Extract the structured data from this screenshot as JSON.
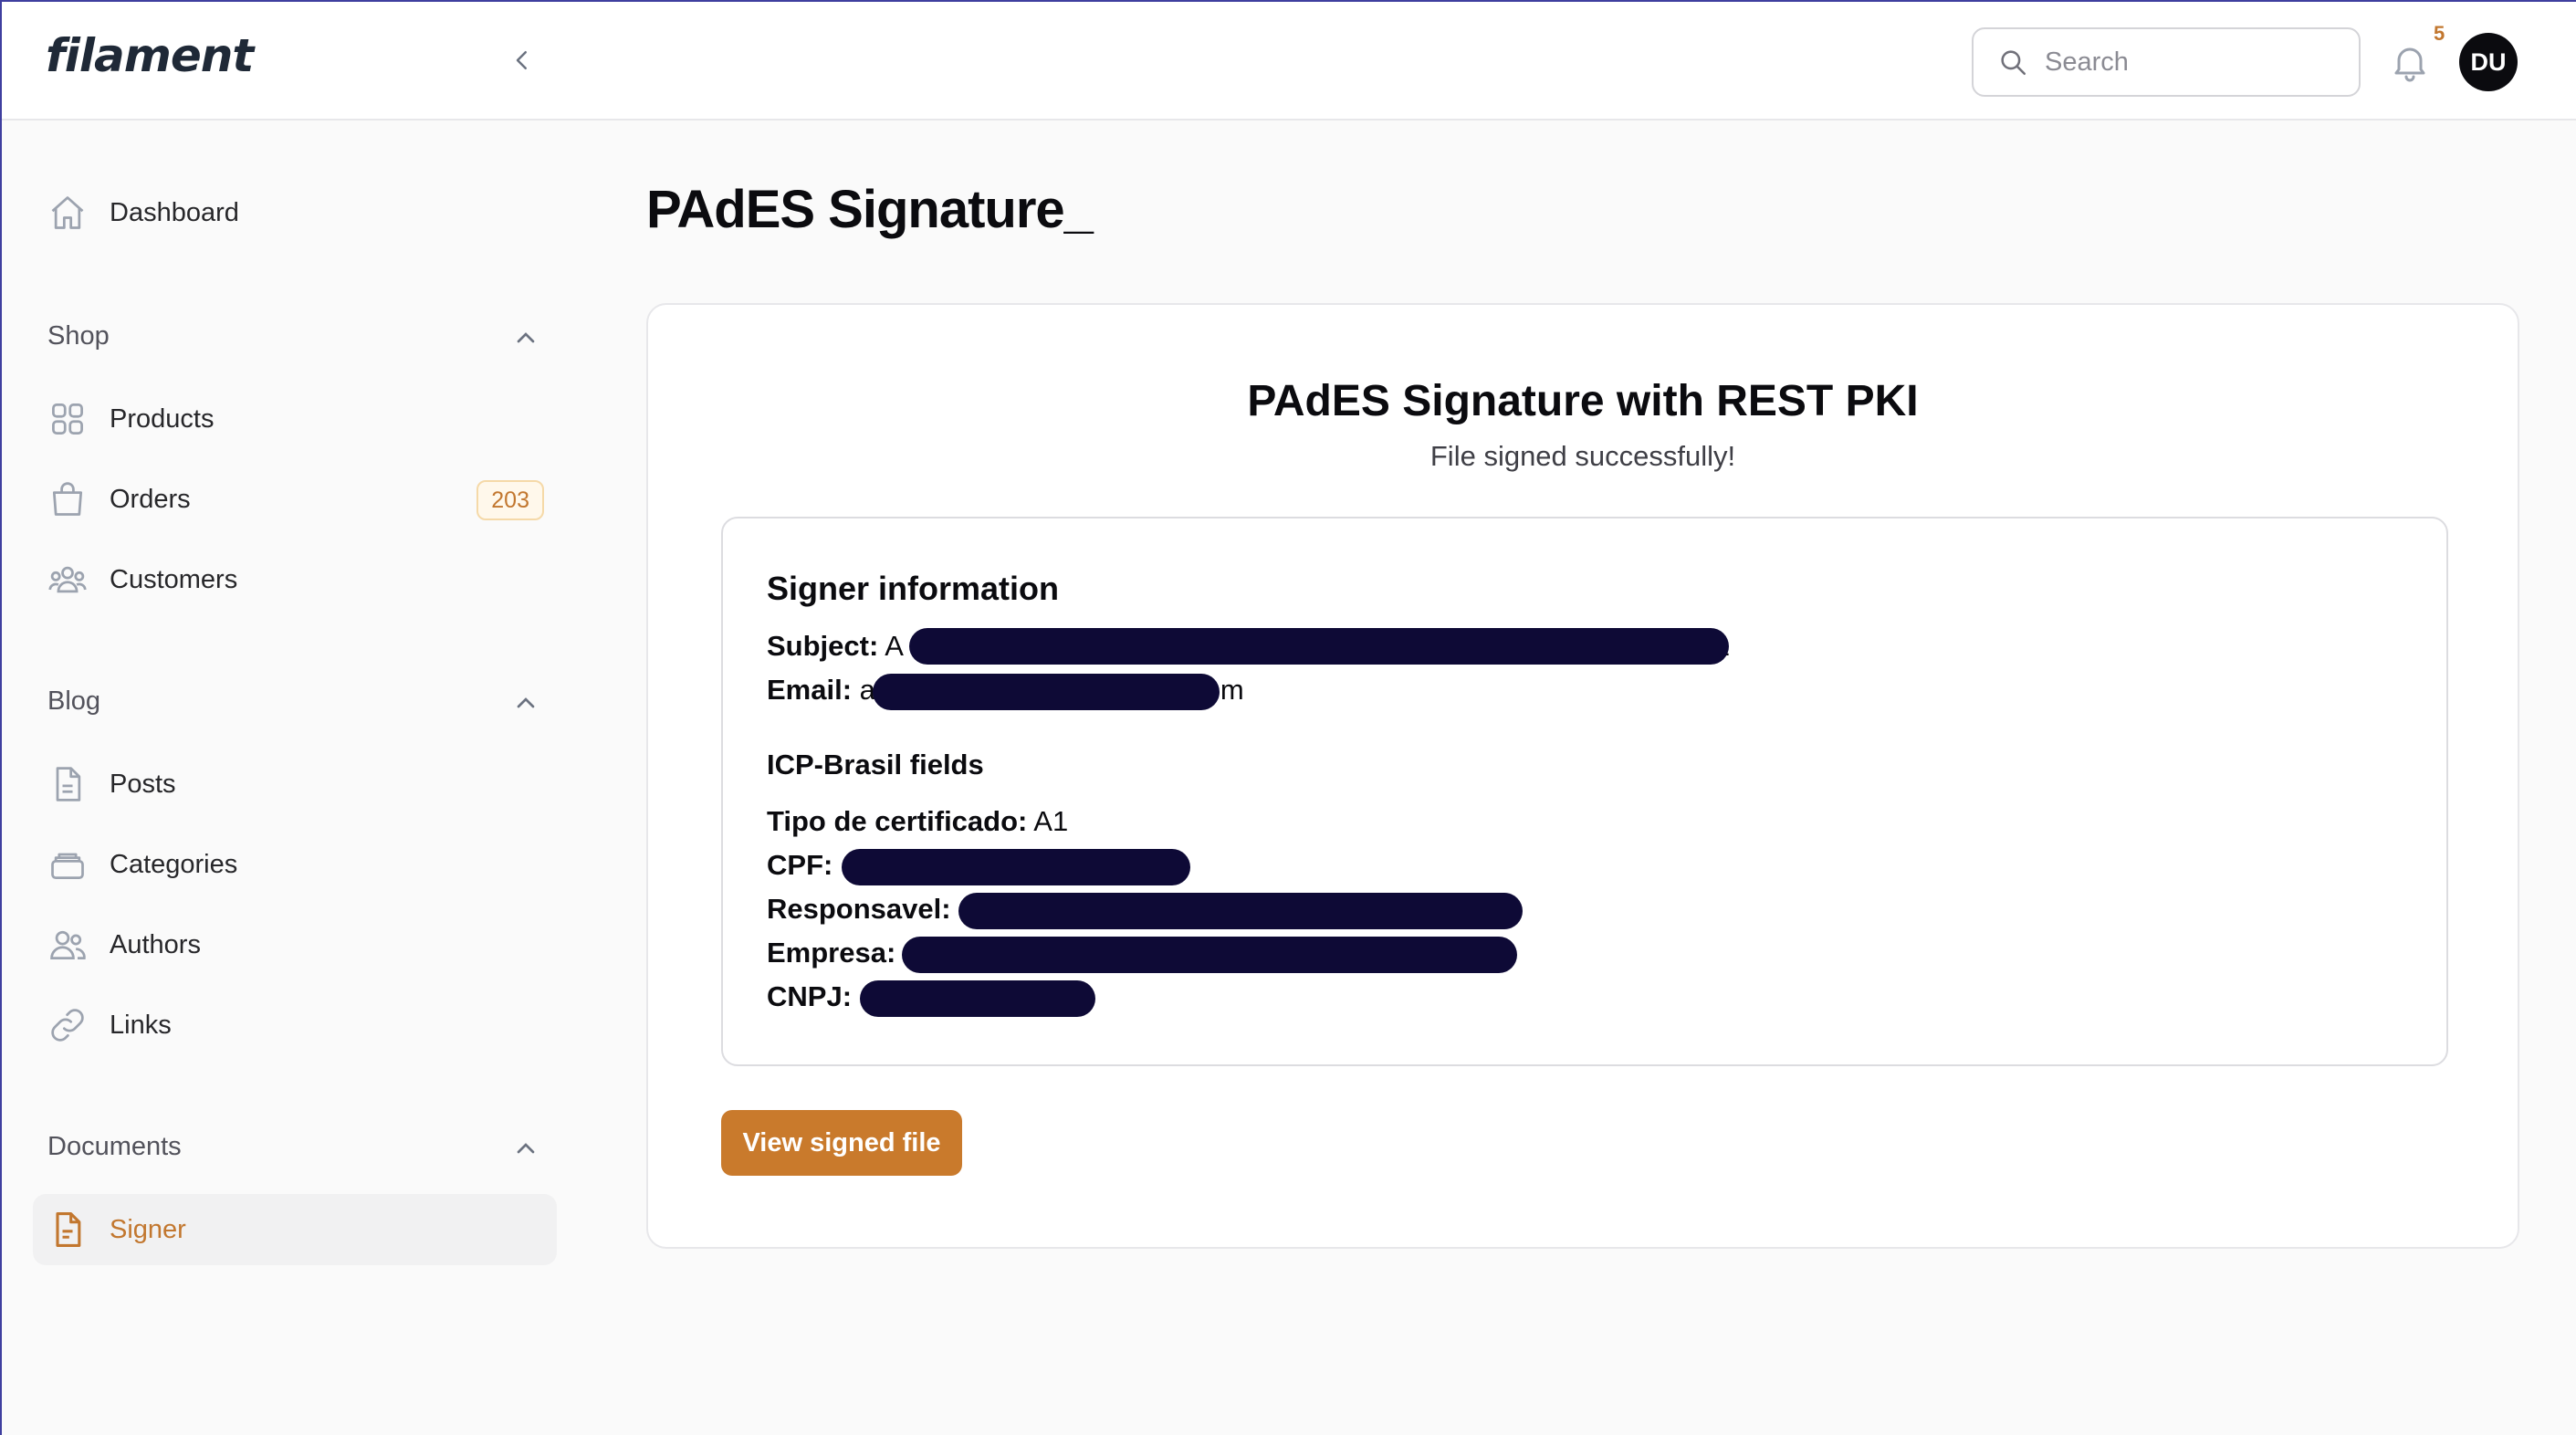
{
  "app": {
    "logo": "filament"
  },
  "header": {
    "search_placeholder": "Search",
    "notification_count": "5",
    "avatar_initials": "DU"
  },
  "sidebar": {
    "dashboard": "Dashboard",
    "groups": {
      "shop": "Shop",
      "blog": "Blog",
      "documents": "Documents"
    },
    "items": {
      "products": "Products",
      "orders": "Orders",
      "orders_badge": "203",
      "customers": "Customers",
      "posts": "Posts",
      "categories": "Categories",
      "authors": "Authors",
      "links": "Links",
      "signer": "Signer"
    },
    "accent_color": "#c2772f"
  },
  "page": {
    "title": "PAdES Signature_",
    "card": {
      "title": "PAdES Signature with REST PKI",
      "subtitle": "File signed successfully!",
      "signer_heading": "Signer information",
      "subject_label": "Subject:",
      "subject_prefix": "A",
      "subject_suffix": "1",
      "email_label": "Email:",
      "email_prefix": "a",
      "email_suffix": "m",
      "icp_heading": "ICP-Brasil fields",
      "tipo_label": "Tipo de certificado:",
      "tipo_value": "A1",
      "cpf_label": "CPF:",
      "responsavel_label": "Responsavel:",
      "empresa_label": "Empresa:",
      "cnpj_label": "CNPJ:",
      "button": "View signed file"
    }
  }
}
